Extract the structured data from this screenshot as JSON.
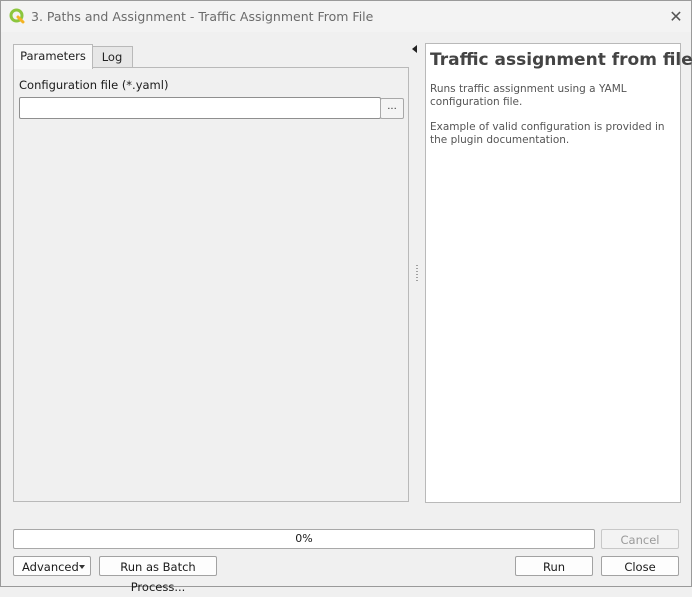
{
  "window": {
    "title": "3. Paths and Assignment - Traffic Assignment From File",
    "close_glyph": "✕"
  },
  "tabs": [
    {
      "label": "Parameters",
      "active": true
    },
    {
      "label": "Log",
      "active": false
    }
  ],
  "parameters": {
    "config_label": "Configuration file (*.yaml)",
    "config_value": "",
    "browse_label": "..."
  },
  "help": {
    "title": "Traffic assignment from file",
    "paragraph1": "Runs traffic assignment using a YAML configuration file.",
    "paragraph2": "Example of valid configuration is provided in the plugin documentation."
  },
  "progress": {
    "value": 0,
    "text": "0%",
    "fill_color": "#06b025"
  },
  "buttons": {
    "cancel": "Cancel",
    "advanced": "Advanced",
    "batch": "Run as Batch Process...",
    "run": "Run",
    "close": "Close"
  },
  "icons": {
    "app_logo": "qgis-logo-icon",
    "collapse": "collapse-arrow-icon",
    "splitter": "splitter-handle-icon",
    "dropdown": "chevron-down-icon"
  }
}
